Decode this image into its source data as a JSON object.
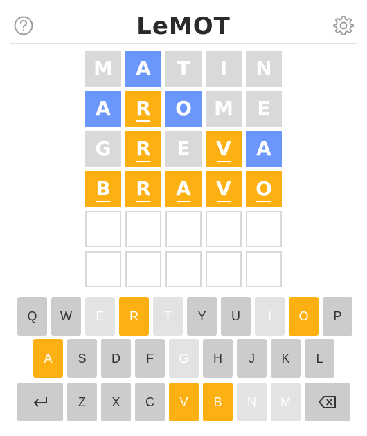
{
  "header": {
    "title": "LeMOT",
    "help_icon": "help-circle-icon",
    "settings_icon": "gear-icon"
  },
  "colors": {
    "correct": "#6b96fb",
    "present": "#fdb012",
    "absent": "#d9d9d9",
    "unused_key": "#cccccc"
  },
  "board": {
    "rows": [
      [
        {
          "l": "M",
          "s": "absent"
        },
        {
          "l": "A",
          "s": "correct"
        },
        {
          "l": "T",
          "s": "absent"
        },
        {
          "l": "I",
          "s": "absent"
        },
        {
          "l": "N",
          "s": "absent"
        }
      ],
      [
        {
          "l": "A",
          "s": "correct"
        },
        {
          "l": "R",
          "s": "present"
        },
        {
          "l": "O",
          "s": "correct"
        },
        {
          "l": "M",
          "s": "absent"
        },
        {
          "l": "E",
          "s": "absent"
        }
      ],
      [
        {
          "l": "G",
          "s": "absent"
        },
        {
          "l": "R",
          "s": "present"
        },
        {
          "l": "E",
          "s": "absent"
        },
        {
          "l": "V",
          "s": "present"
        },
        {
          "l": "A",
          "s": "correct"
        }
      ],
      [
        {
          "l": "B",
          "s": "present"
        },
        {
          "l": "R",
          "s": "present"
        },
        {
          "l": "A",
          "s": "present"
        },
        {
          "l": "V",
          "s": "present"
        },
        {
          "l": "O",
          "s": "present"
        }
      ],
      [
        {
          "l": "",
          "s": "empty"
        },
        {
          "l": "",
          "s": "empty"
        },
        {
          "l": "",
          "s": "empty"
        },
        {
          "l": "",
          "s": "empty"
        },
        {
          "l": "",
          "s": "empty"
        }
      ],
      [
        {
          "l": "",
          "s": "empty"
        },
        {
          "l": "",
          "s": "empty"
        },
        {
          "l": "",
          "s": "empty"
        },
        {
          "l": "",
          "s": "empty"
        },
        {
          "l": "",
          "s": "empty"
        }
      ]
    ]
  },
  "keyboard": {
    "rows": [
      [
        {
          "k": "Q",
          "s": "unknown"
        },
        {
          "k": "W",
          "s": "unknown"
        },
        {
          "k": "E",
          "s": "absent"
        },
        {
          "k": "R",
          "s": "present"
        },
        {
          "k": "T",
          "s": "absent"
        },
        {
          "k": "Y",
          "s": "unknown"
        },
        {
          "k": "U",
          "s": "unknown"
        },
        {
          "k": "I",
          "s": "absent"
        },
        {
          "k": "O",
          "s": "present"
        },
        {
          "k": "P",
          "s": "unknown"
        }
      ],
      [
        {
          "k": "A",
          "s": "present"
        },
        {
          "k": "S",
          "s": "unknown"
        },
        {
          "k": "D",
          "s": "unknown"
        },
        {
          "k": "F",
          "s": "unknown"
        },
        {
          "k": "G",
          "s": "absent"
        },
        {
          "k": "H",
          "s": "unknown"
        },
        {
          "k": "J",
          "s": "unknown"
        },
        {
          "k": "K",
          "s": "unknown"
        },
        {
          "k": "L",
          "s": "unknown"
        }
      ],
      [
        {
          "k": "enter",
          "s": "unknown",
          "icon": "enter-icon"
        },
        {
          "k": "Z",
          "s": "unknown"
        },
        {
          "k": "X",
          "s": "unknown"
        },
        {
          "k": "C",
          "s": "unknown"
        },
        {
          "k": "V",
          "s": "present"
        },
        {
          "k": "B",
          "s": "present"
        },
        {
          "k": "N",
          "s": "absent"
        },
        {
          "k": "M",
          "s": "absent"
        },
        {
          "k": "backspace",
          "s": "unknown",
          "icon": "backspace-icon"
        }
      ]
    ]
  }
}
